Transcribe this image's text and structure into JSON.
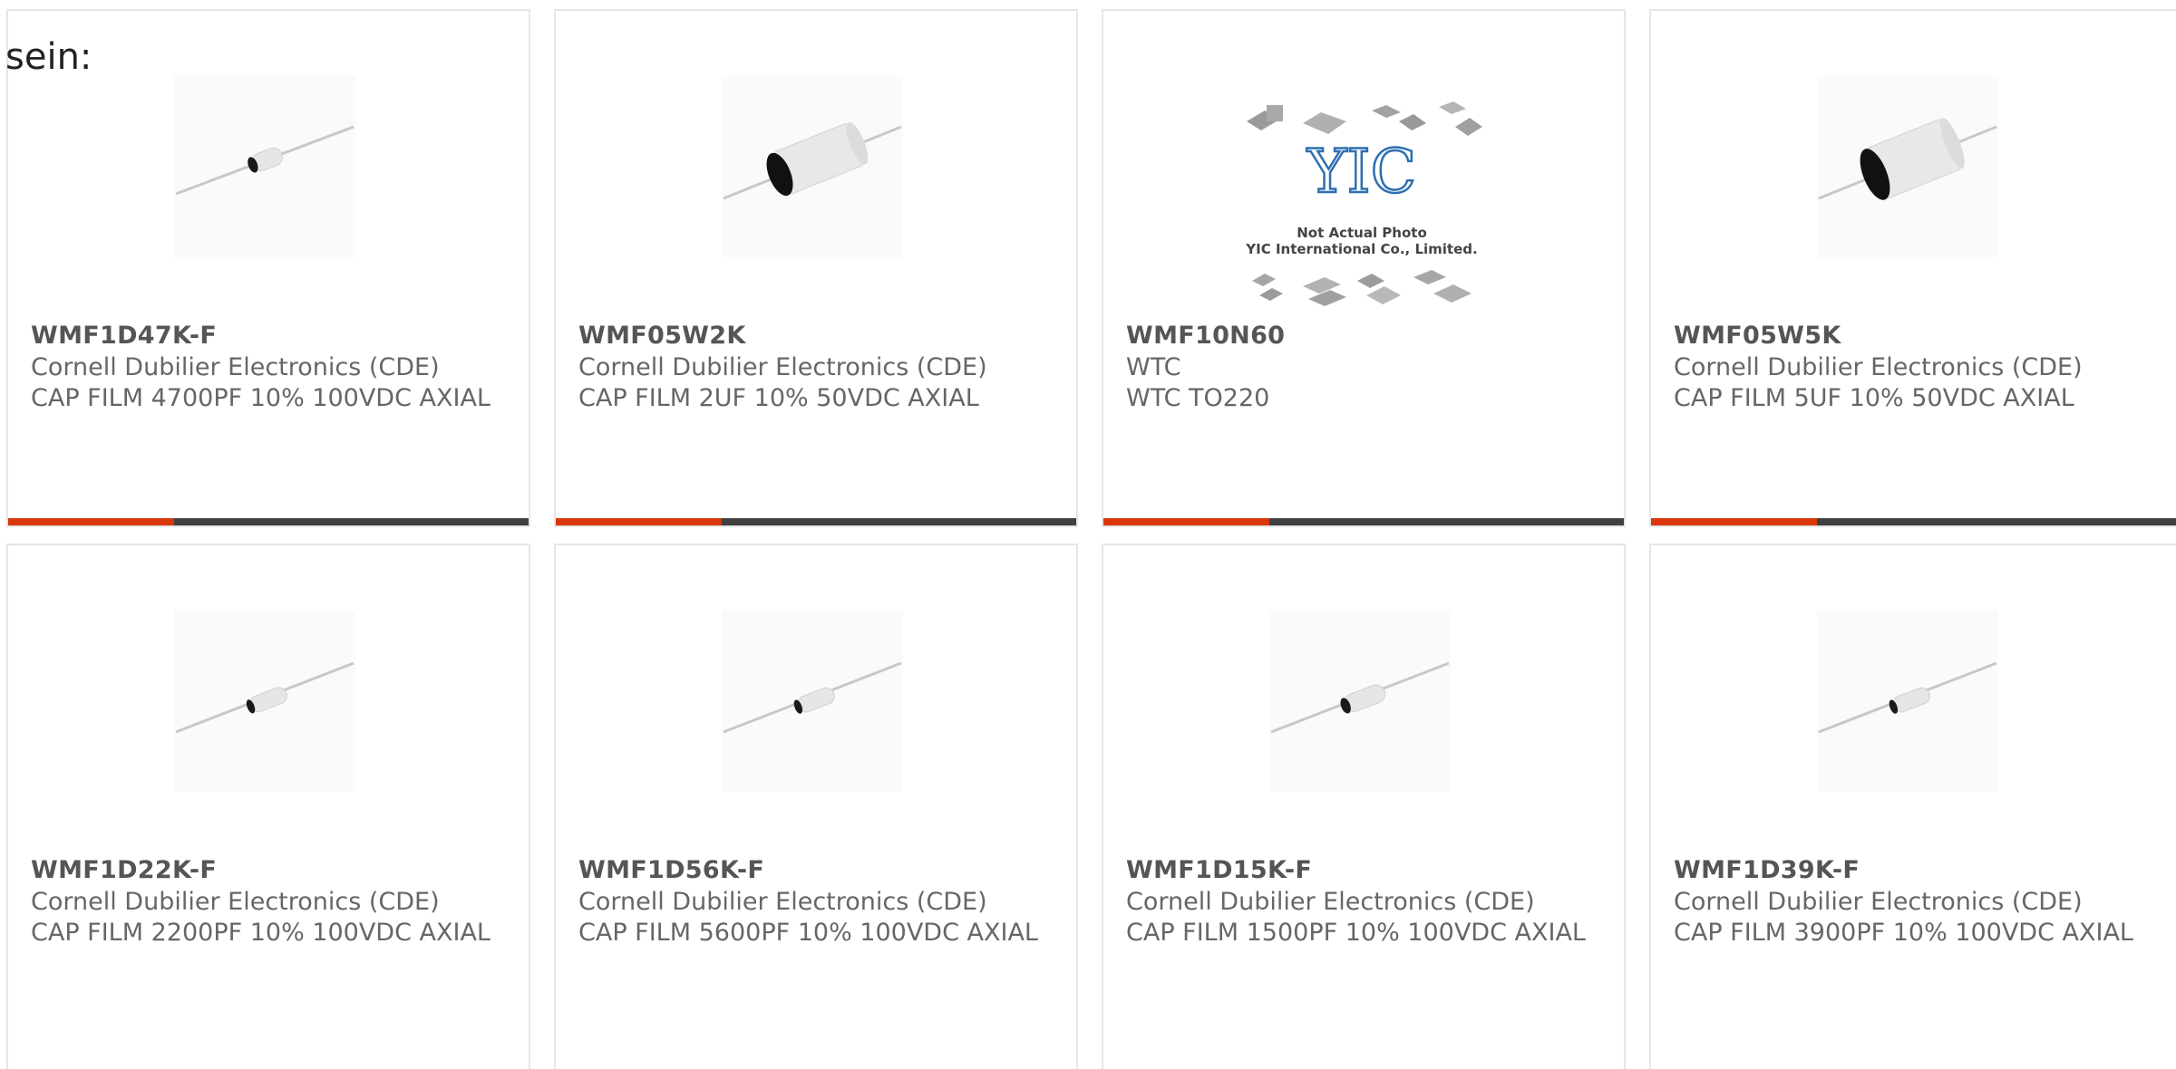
{
  "intro_text": "sein:",
  "colors": {
    "accent": "#d9360b",
    "bar": "#404040",
    "border": "#e6e6e6",
    "text": "#666666"
  },
  "products": [
    {
      "part": "WMF1D47K-F",
      "manufacturer": "Cornell Dubilier Electronics (CDE)",
      "description": "CAP FILM 4700PF 10% 100VDC AXIAL",
      "image": "small-axial-capacitor"
    },
    {
      "part": "WMF05W2K",
      "manufacturer": "Cornell Dubilier Electronics (CDE)",
      "description": "CAP FILM 2UF 10% 50VDC AXIAL",
      "image": "large-axial-capacitor"
    },
    {
      "part": "WMF10N60",
      "manufacturer": "WTC",
      "description": "WTC TO220",
      "image": "yic-placeholder",
      "placeholder_caption_1": "Not Actual Photo",
      "placeholder_caption_2": "YIC International Co., Limited.",
      "placeholder_logo": "YIC"
    },
    {
      "part": "WMF05W5K",
      "manufacturer": "Cornell Dubilier Electronics (CDE)",
      "description": "CAP FILM 5UF 10% 50VDC AXIAL",
      "image": "large-axial-capacitor"
    },
    {
      "part": "WMF1D22K-F",
      "manufacturer": "Cornell Dubilier Electronics (CDE)",
      "description": "CAP FILM 2200PF 10% 100VDC AXIAL",
      "image": "small-axial-capacitor"
    },
    {
      "part": "WMF1D56K-F",
      "manufacturer": "Cornell Dubilier Electronics (CDE)",
      "description": "CAP FILM 5600PF 10% 100VDC AXIAL",
      "image": "small-axial-capacitor"
    },
    {
      "part": "WMF1D15K-F",
      "manufacturer": "Cornell Dubilier Electronics (CDE)",
      "description": "CAP FILM 1500PF 10% 100VDC AXIAL",
      "image": "small-axial-capacitor"
    },
    {
      "part": "WMF1D39K-F",
      "manufacturer": "Cornell Dubilier Electronics (CDE)",
      "description": "CAP FILM 3900PF 10% 100VDC AXIAL",
      "image": "small-axial-capacitor"
    }
  ]
}
